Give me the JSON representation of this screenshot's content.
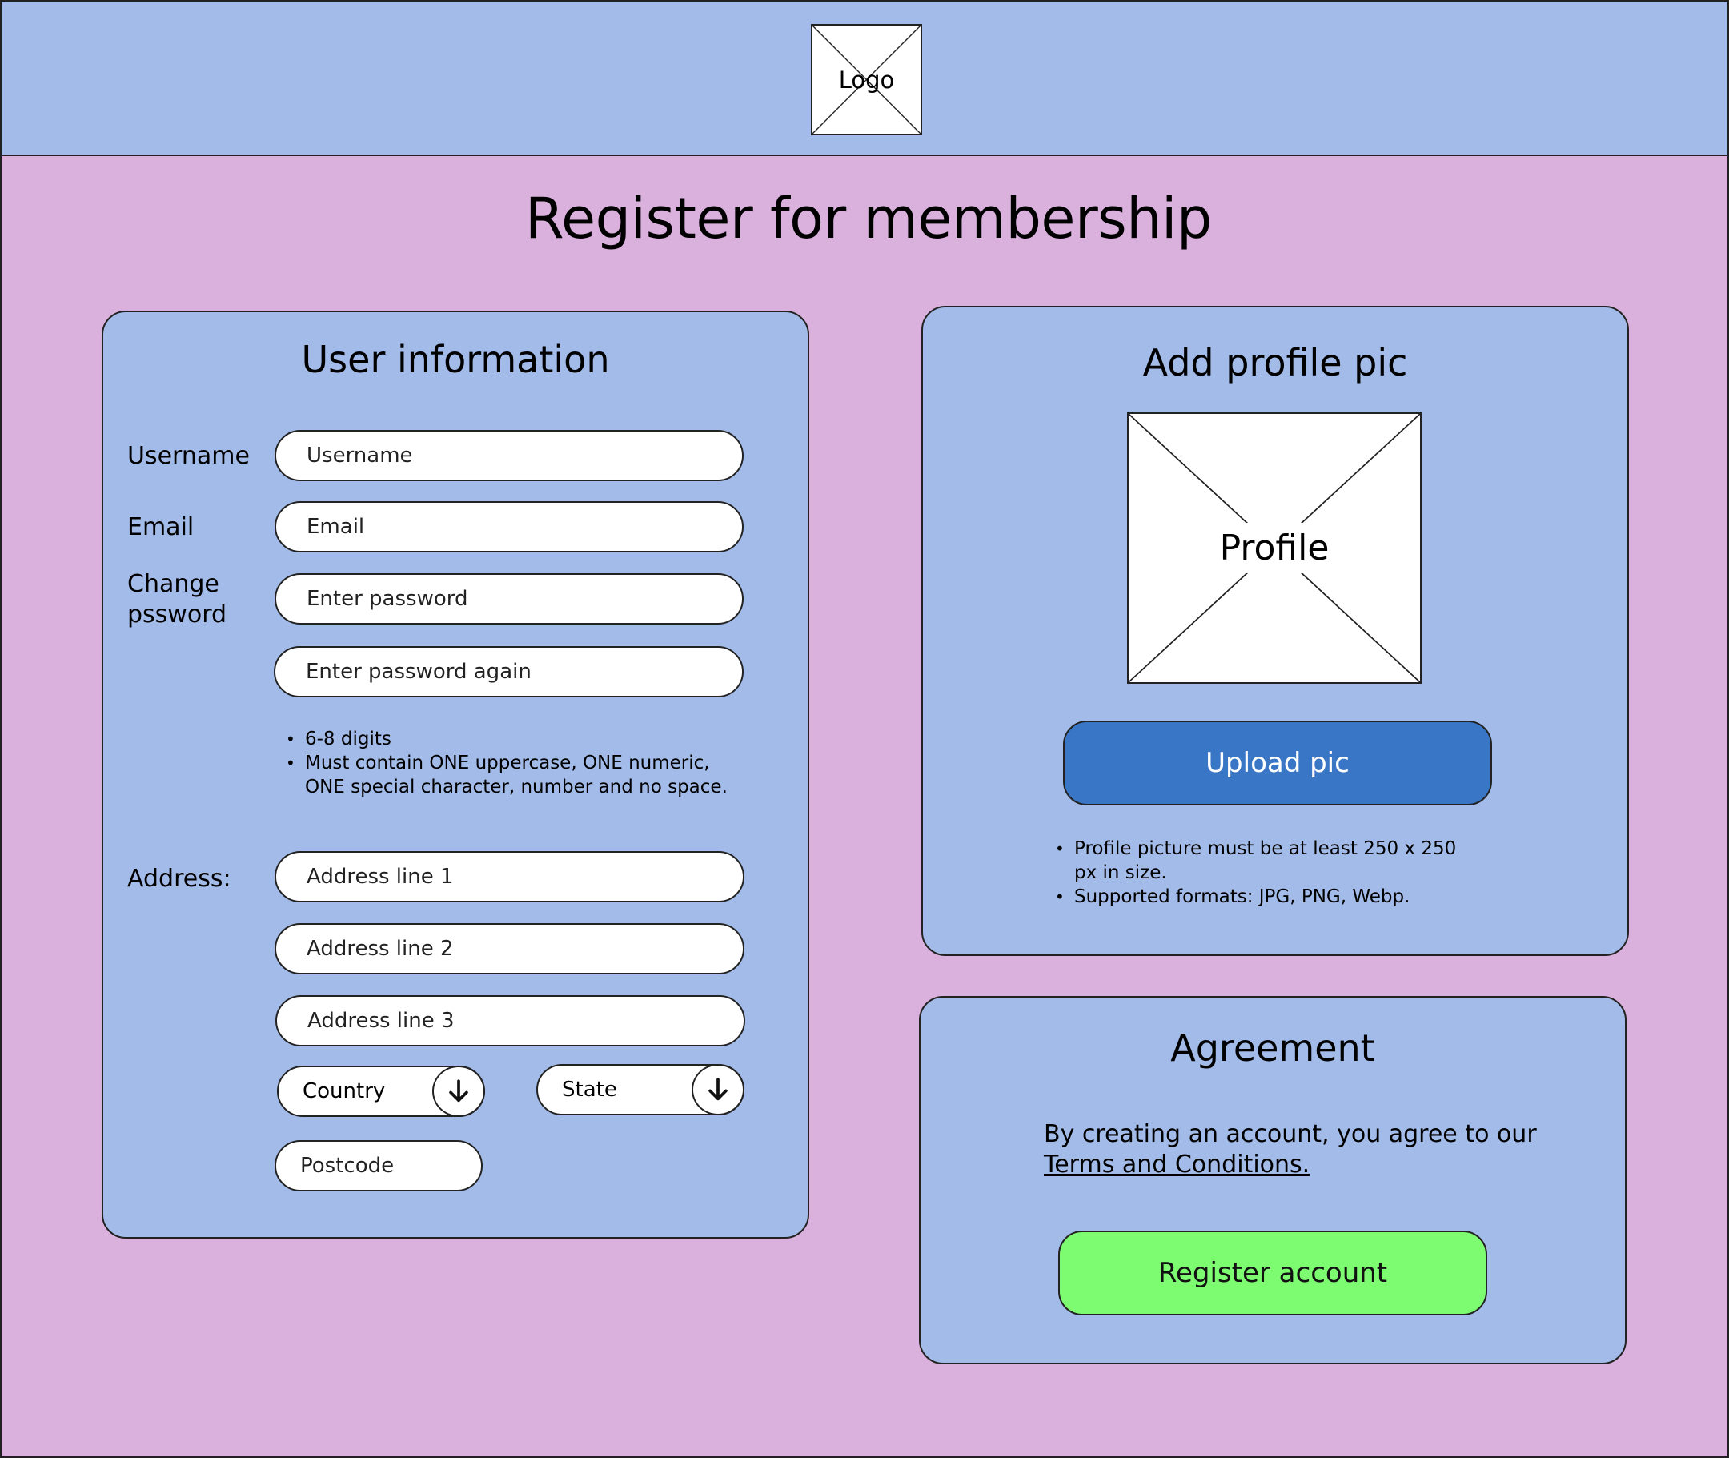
{
  "header": {
    "logo_text": "Logo"
  },
  "page_title": "Register for membership",
  "user_info": {
    "title": "User information",
    "labels": {
      "username": "Username",
      "email": "Email",
      "change_password_line1": "Change",
      "change_password_line2": "pssword",
      "address": "Address:"
    },
    "placeholders": {
      "username": "Username",
      "email": "Email",
      "password": "Enter password",
      "password_again": "Enter password again",
      "address1": "Address line 1",
      "address2": "Address line 2",
      "address3": "Address line 3",
      "postcode": "Postcode"
    },
    "country_select": "Country",
    "state_select": "State",
    "password_rules": [
      "6-8 digits",
      "Must contain ONE uppercase, ONE numeric, ONE special character, number and no space."
    ]
  },
  "profile": {
    "title": "Add profile pic",
    "placeholder_text": "Profile",
    "upload_label": "Upload pic",
    "rules": [
      "Profile picture must be at least 250 x 250 px in size.",
      "Supported formats: JPG, PNG, Webp."
    ]
  },
  "agreement": {
    "title": "Agreement",
    "text": "By creating an account, you agree to our",
    "link": "Terms and Conditions.",
    "register_label": "Register account"
  },
  "colors": {
    "page_bg": "#d9b1dc",
    "panel_bg": "#a3bbe8",
    "upload_button": "#3a76c6",
    "register_button": "#7dfc72"
  },
  "icons": {
    "logo": "image-placeholder-icon",
    "profile": "image-placeholder-icon",
    "select_arrow": "arrow-down-icon"
  }
}
